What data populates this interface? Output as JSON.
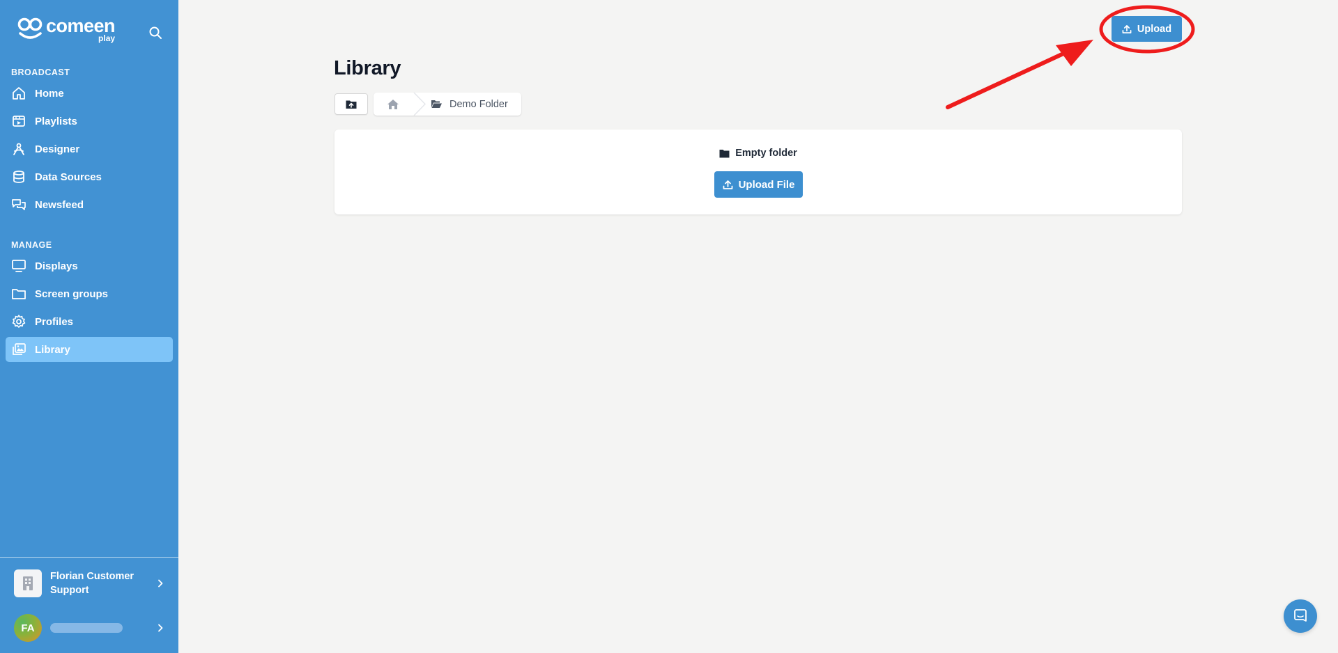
{
  "brand": {
    "name": "comeen",
    "sub": "play"
  },
  "sidebar": {
    "sections": [
      {
        "label": "BROADCAST",
        "items": [
          {
            "label": "Home",
            "icon": "home-icon"
          },
          {
            "label": "Playlists",
            "icon": "playlists-icon"
          },
          {
            "label": "Designer",
            "icon": "designer-icon"
          },
          {
            "label": "Data Sources",
            "icon": "database-icon"
          },
          {
            "label": "Newsfeed",
            "icon": "newsfeed-icon"
          }
        ]
      },
      {
        "label": "MANAGE",
        "items": [
          {
            "label": "Displays",
            "icon": "monitor-icon"
          },
          {
            "label": "Screen groups",
            "icon": "folder-icon"
          },
          {
            "label": "Profiles",
            "icon": "gear-icon"
          },
          {
            "label": "Library",
            "icon": "library-icon",
            "active": true
          }
        ]
      }
    ],
    "organization": "Florian Customer Support",
    "user_initials": "FA"
  },
  "main": {
    "title": "Library",
    "breadcrumb": {
      "current_folder": "Demo Folder"
    },
    "empty_state": {
      "message": "Empty folder",
      "upload_file_label": "Upload File"
    },
    "upload_label": "Upload"
  },
  "colors": {
    "sidebar": "#4292d3",
    "active_item": "#7ec4f8",
    "primary_button": "#3d8fd0",
    "annotation": "#ee1c1c"
  }
}
